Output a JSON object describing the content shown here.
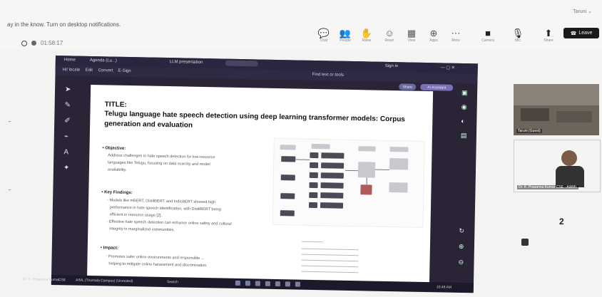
{
  "teams": {
    "notification": "ay in the know. Turn on desktop notifications.",
    "recording_time": "01:58:17",
    "user_menu": "Taruni ⌄",
    "toolbar": [
      {
        "label": "Chat",
        "icon": "chat-icon"
      },
      {
        "label": "People",
        "icon": "people-icon"
      },
      {
        "label": "Raise",
        "icon": "raise-hand-icon"
      },
      {
        "label": "React",
        "icon": "react-icon"
      },
      {
        "label": "View",
        "icon": "view-icon"
      },
      {
        "label": "Apps",
        "icon": "apps-icon"
      },
      {
        "label": "More",
        "icon": "more-icon"
      },
      {
        "label": "Camera",
        "icon": "camera-icon"
      },
      {
        "label": "Mic",
        "icon": "mic-icon"
      },
      {
        "label": "Share",
        "icon": "share-icon"
      }
    ],
    "leave_label": "Leave",
    "people_count": "2"
  },
  "shared_app": {
    "title_bar": [
      "Home",
      "Agenda (Lu...)",
      "LLM presentation"
    ],
    "menu": [
      "Hi! locale",
      "Edit",
      "Convert",
      "E-Sign"
    ],
    "tab_label": "Tab",
    "signin": "Sign in",
    "find_text": "Find text or tools",
    "pill_1": "Share",
    "pill_2": "AI Assistant"
  },
  "document": {
    "title": "TITLE:",
    "heading": "Telugu language hate speech detection using deep learning transformer models: Corpus generation and evaluation",
    "sections": [
      {
        "heading": "• Objective:",
        "lines": [
          "Address challenges in hate speech detection for low-resource",
          "languages like Telugu, focusing on data scarcity and model",
          "availability."
        ]
      },
      {
        "heading": "• Key Findings:",
        "lines": [
          "- Models like mBERT, DistilBERT, and IndicBERT showed high",
          "performance in hate speech identification, with DistilBERT being",
          "efficient in resource usage [2].",
          "- Effective hate speech detection can enhance online safety and cultural",
          "integrity in marginalized communities."
        ]
      },
      {
        "heading": "• Impact:",
        "lines": [
          "- Promotes safer online environments and responsible ...",
          "helping to mitigate online harassment and discrimination."
        ]
      }
    ]
  },
  "taskbar": {
    "items": [
      "Dr. K. Prasanna Kumar",
      "CSE",
      "AIML (Tirumala Campus) (Unmuted)",
      "Search"
    ],
    "clock": "10:48 AM"
  },
  "participants": [
    {
      "label": "Taruni (Guest)"
    },
    {
      "label": "Dr. K. Prasanna Kumar CSE - AI&ML"
    }
  ]
}
